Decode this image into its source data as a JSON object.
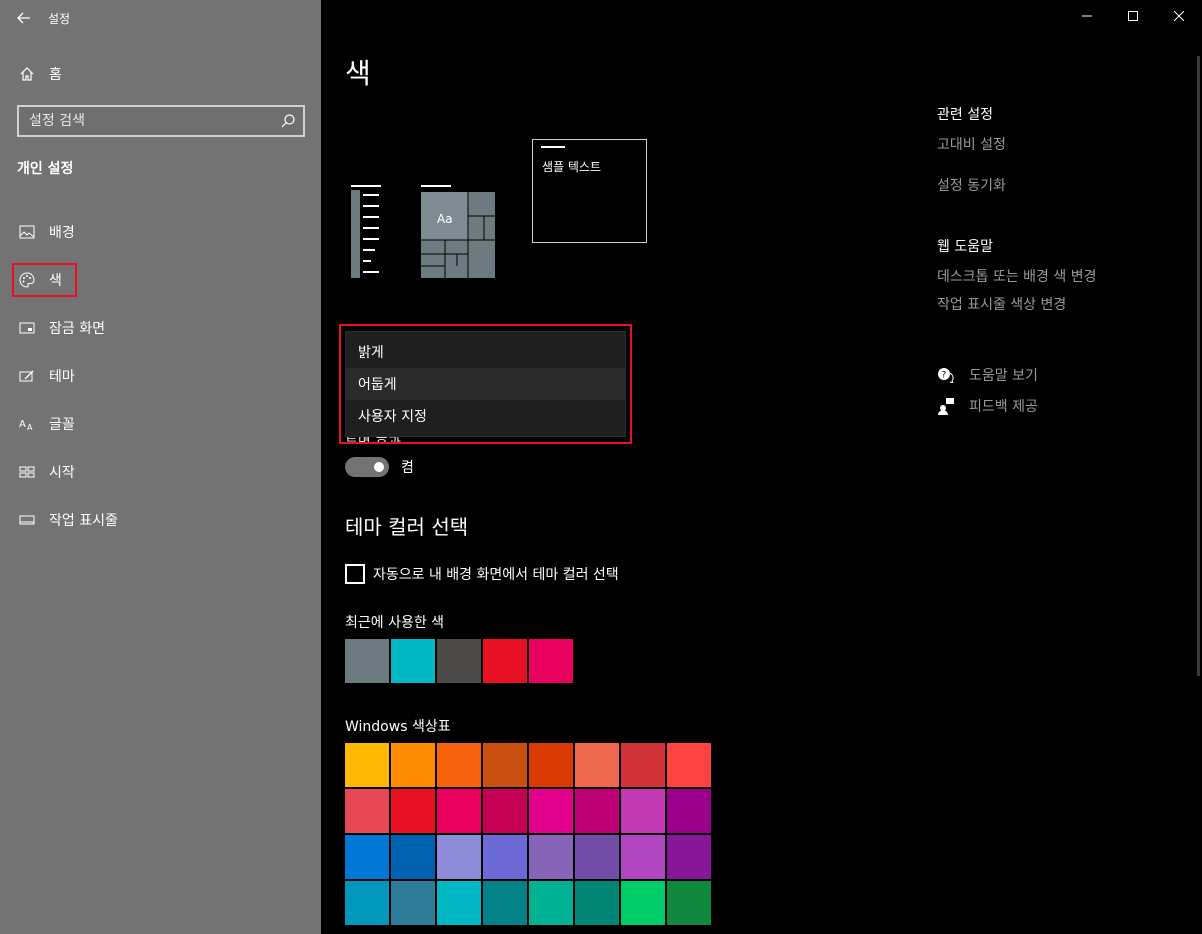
{
  "app": {
    "title": "설정"
  },
  "sidebar": {
    "home_label": "홈",
    "search_placeholder": "설정 검색",
    "section_title": "개인 설정",
    "items": [
      {
        "label": "배경",
        "icon": "picture-icon"
      },
      {
        "label": "색",
        "icon": "palette-icon",
        "active": true
      },
      {
        "label": "잠금 화면",
        "icon": "lock-screen-icon"
      },
      {
        "label": "테마",
        "icon": "theme-icon"
      },
      {
        "label": "글꼴",
        "icon": "font-icon"
      },
      {
        "label": "시작",
        "icon": "start-icon"
      },
      {
        "label": "작업 표시줄",
        "icon": "taskbar-icon"
      }
    ]
  },
  "main": {
    "title": "색",
    "sample_text": "샘플 텍스트",
    "preview_aa": "Aa",
    "dropdown": {
      "options": [
        "밝게",
        "어둡게",
        "사용자 지정"
      ],
      "selected": "어둡게"
    },
    "transparency_label_partial": "투명 효과",
    "toggle_state": "켬",
    "accent_heading": "테마 컬러 선택",
    "auto_pick_label": "자동으로 내 배경 화면에서 테마 컬러 선택",
    "recent_label": "최근에 사용한 색",
    "recent_colors": [
      "#6b7b80",
      "#00b7c3",
      "#4c4a48",
      "#e81123",
      "#ea005e"
    ],
    "palette_label": "Windows 색상표",
    "palette": [
      [
        "#ffb900",
        "#ff8c00",
        "#f7630c",
        "#ca5010",
        "#da3b01",
        "#ef6950",
        "#d13438",
        "#ff4343"
      ],
      [
        "#e74856",
        "#e81123",
        "#ea005e",
        "#c30052",
        "#e3008c",
        "#bf0077",
        "#c239b3",
        "#9a0089"
      ],
      [
        "#0078d7",
        "#0063b1",
        "#8e8cd8",
        "#6b69d6",
        "#8764b8",
        "#744da9",
        "#b146c2",
        "#881798"
      ],
      [
        "#0099bc",
        "#2d7d9a",
        "#00b7c3",
        "#038387",
        "#00b294",
        "#018574",
        "#00cc6a",
        "#10893e"
      ]
    ]
  },
  "related": {
    "heading": "관련 설정",
    "links": [
      "고대비 설정",
      "설정 동기화"
    ],
    "web_help_heading": "웹 도움말",
    "web_links": [
      "데스크톱 또는 배경 색 변경",
      "작업 표시줄 색상 변경"
    ],
    "get_help": "도움말 보기",
    "give_feedback": "피드백 제공"
  }
}
